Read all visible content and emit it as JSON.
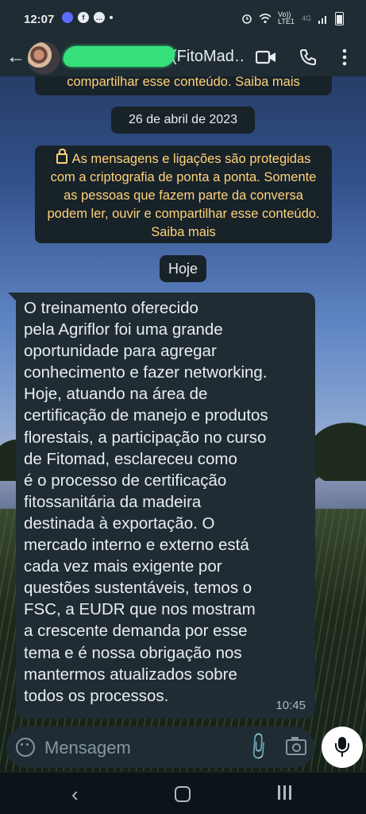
{
  "status_bar": {
    "time": "12:07",
    "left_icons": [
      "messenger-icon",
      "facebook-icon",
      "chat-icon",
      "dot"
    ],
    "right_icons": [
      "alarm-icon",
      "wifi-icon",
      "volte-icon",
      "signal-icon",
      "battery-icon"
    ],
    "volte_label": "Vo)) LTE1",
    "network": "4G"
  },
  "app_bar": {
    "contact_name": "(FitoMad…",
    "actions": [
      "video-call-icon",
      "phone-icon",
      "more-icon"
    ]
  },
  "chat": {
    "top_system_tail": "compartilhar esse conteúdo. Saiba mais",
    "date_chip": "26 de abril de 2023",
    "encryption_notice": "As mensagens e ligações são protegidas com a criptografia de ponta a ponta. Somente as pessoas que fazem parte da conversa podem ler, ouvir e compartilhar esse conteúdo. Saiba mais",
    "today_chip": "Hoje",
    "message": {
      "text": "O treinamento oferecido\npela Agriflor foi uma grande\noportunidade para agregar\nconhecimento e fazer networking.\nHoje, atuando na área de\ncertificação de manejo e produtos\nflorestais, a participação no curso\nde Fitomad, esclareceu como\né o processo de certificação\nfitossanitária da madeira\ndestinada à exportação. O\nmercado interno e externo está\ncada vez mais exigente por\nquestões sustentáveis, temos o\nFSC, a EUDR que nos mostram\na crescente demanda por esse\ntema e é nossa obrigação nos\nmantermos atualizados sobre\ntodos os processos.",
      "time": "10:45"
    }
  },
  "composer": {
    "placeholder": "Mensagem"
  },
  "colors": {
    "bar_bg": "#1f2c33",
    "bubble_bg": "#202c33",
    "system_text": "#ffd279",
    "redaction": "#35e07a"
  }
}
